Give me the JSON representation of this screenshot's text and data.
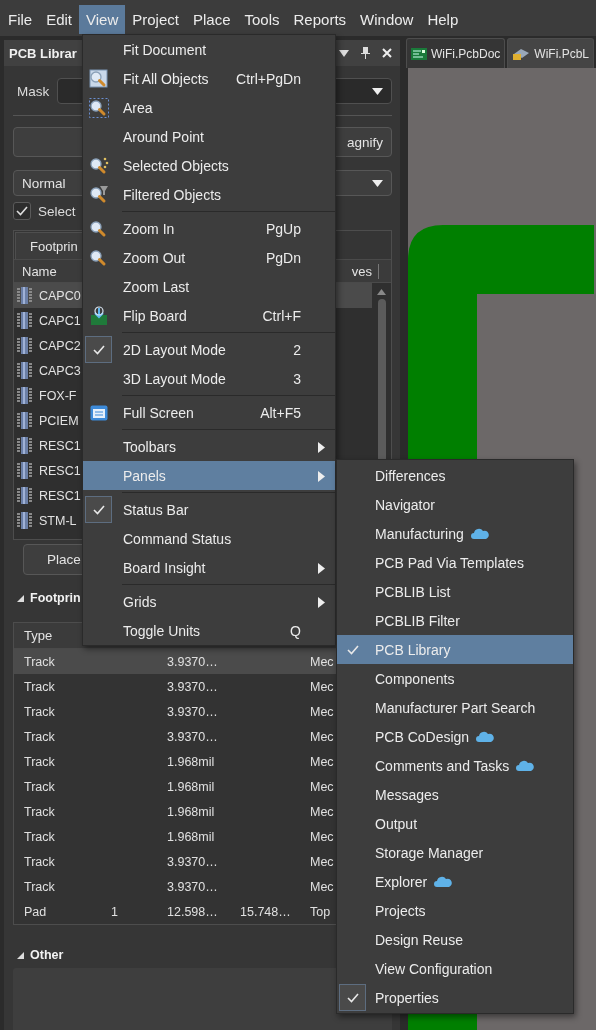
{
  "menubar": [
    {
      "label": "File",
      "selected": false
    },
    {
      "label": "Edit",
      "selected": false
    },
    {
      "label": "View",
      "selected": true
    },
    {
      "label": "Project",
      "selected": false
    },
    {
      "label": "Place",
      "selected": false
    },
    {
      "label": "Tools",
      "selected": false
    },
    {
      "label": "Reports",
      "selected": false
    },
    {
      "label": "Window",
      "selected": false
    },
    {
      "label": "Help",
      "selected": false
    }
  ],
  "panel": {
    "title": "PCB Librar",
    "mask_label": "Mask",
    "button_label": "agnify",
    "mode": "Normal",
    "select": {
      "label": "Select",
      "checked": true
    },
    "footprints": {
      "tab": "Footprin",
      "columns": [
        "Name",
        "ves"
      ],
      "rows": [
        {
          "name": "CAPC0",
          "selected": true
        },
        {
          "name": "CAPC1",
          "selected": false
        },
        {
          "name": "CAPC2",
          "selected": false
        },
        {
          "name": "CAPC3",
          "selected": false
        },
        {
          "name": "FOX-F",
          "selected": false
        },
        {
          "name": "PCIEM",
          "selected": false
        },
        {
          "name": "RESC1",
          "selected": false
        },
        {
          "name": "RESC1",
          "selected": false
        },
        {
          "name": "RESC1",
          "selected": false
        },
        {
          "name": "STM-L",
          "selected": false
        }
      ]
    },
    "place_button": "Place",
    "primitives": {
      "title": "Footprin",
      "columns": [
        "Type"
      ],
      "rows": [
        {
          "type": "Track",
          "column_3": "3.9370…",
          "column_5": "Mec",
          "selected": true
        },
        {
          "type": "Track",
          "column_3": "3.9370…",
          "column_5": "Mec",
          "selected": false
        },
        {
          "type": "Track",
          "column_3": "3.9370…",
          "column_5": "Mec",
          "selected": false
        },
        {
          "type": "Track",
          "column_3": "3.9370…",
          "column_5": "Mec",
          "selected": false
        },
        {
          "type": "Track",
          "column_3": "1.968mil",
          "column_5": "Mec",
          "selected": false
        },
        {
          "type": "Track",
          "column_3": "1.968mil",
          "column_5": "Mec",
          "selected": false
        },
        {
          "type": "Track",
          "column_3": "1.968mil",
          "column_5": "Mec",
          "selected": false
        },
        {
          "type": "Track",
          "column_3": "1.968mil",
          "column_5": "Mec",
          "selected": false
        },
        {
          "type": "Track",
          "column_3": "3.9370…",
          "column_5": "Mec",
          "selected": false
        },
        {
          "type": "Track",
          "column_3": "3.9370…",
          "column_5": "Mec",
          "selected": false
        },
        {
          "type": "Pad",
          "column_2": "1",
          "column_3": "12.598…",
          "column_4": "15.748…",
          "column_5": "Top",
          "selected": false
        }
      ]
    },
    "other_title": "Other"
  },
  "document_tabs": [
    {
      "label": "WiFi.PcbDoc",
      "selected": true
    },
    {
      "label": "WiFi.PcbL",
      "selected": false
    }
  ],
  "view_menu": [
    {
      "kind": "item",
      "label": "Fit Document",
      "checked": false,
      "submenu": false,
      "selected": false
    },
    {
      "kind": "item",
      "label": "Fit All Objects",
      "shortcut": "Ctrl+PgDn",
      "checked": false,
      "submenu": false,
      "selected": false
    },
    {
      "kind": "item",
      "label": "Area",
      "checked": false,
      "submenu": false,
      "selected": false
    },
    {
      "kind": "item",
      "label": "Around Point",
      "checked": false,
      "submenu": false,
      "selected": false
    },
    {
      "kind": "item",
      "label": "Selected Objects",
      "checked": false,
      "submenu": false,
      "selected": false
    },
    {
      "kind": "item",
      "label": "Filtered Objects",
      "checked": false,
      "submenu": false,
      "selected": false
    },
    {
      "kind": "separator"
    },
    {
      "kind": "item",
      "label": "Zoom In",
      "shortcut": "PgUp",
      "checked": false,
      "submenu": false,
      "selected": false
    },
    {
      "kind": "item",
      "label": "Zoom Out",
      "shortcut": "PgDn",
      "checked": false,
      "submenu": false,
      "selected": false
    },
    {
      "kind": "item",
      "label": "Zoom Last",
      "checked": false,
      "submenu": false,
      "selected": false
    },
    {
      "kind": "item",
      "label": "Flip Board",
      "shortcut": "Ctrl+F",
      "checked": false,
      "submenu": false,
      "selected": false
    },
    {
      "kind": "separator"
    },
    {
      "kind": "item",
      "label": "2D Layout Mode",
      "shortcut": "2",
      "checked": true,
      "submenu": false,
      "selected": false
    },
    {
      "kind": "item",
      "label": "3D Layout Mode",
      "shortcut": "3",
      "checked": false,
      "submenu": false,
      "selected": false
    },
    {
      "kind": "separator"
    },
    {
      "kind": "item",
      "label": "Full Screen",
      "shortcut": "Alt+F5",
      "checked": false,
      "submenu": false,
      "selected": false
    },
    {
      "kind": "separator"
    },
    {
      "kind": "item",
      "label": "Toolbars",
      "checked": false,
      "submenu": true,
      "selected": false
    },
    {
      "kind": "item",
      "label": "Panels",
      "checked": false,
      "submenu": true,
      "selected": true
    },
    {
      "kind": "separator"
    },
    {
      "kind": "item",
      "label": "Status Bar",
      "checked": true,
      "submenu": false,
      "selected": false
    },
    {
      "kind": "item",
      "label": "Command Status",
      "checked": false,
      "submenu": false,
      "selected": false
    },
    {
      "kind": "item",
      "label": "Board Insight",
      "checked": false,
      "submenu": true,
      "selected": false
    },
    {
      "kind": "separator"
    },
    {
      "kind": "item",
      "label": "Grids",
      "checked": false,
      "submenu": true,
      "selected": false
    },
    {
      "kind": "item",
      "label": "Toggle Units",
      "shortcut": "Q",
      "checked": false,
      "submenu": false,
      "selected": false
    }
  ],
  "panels_submenu": [
    {
      "label": "Differences",
      "checked": false,
      "cloud": false,
      "selected": false
    },
    {
      "label": "Navigator",
      "checked": false,
      "cloud": false,
      "selected": false
    },
    {
      "label": "Manufacturing",
      "checked": false,
      "cloud": true,
      "selected": false
    },
    {
      "label": "PCB Pad Via Templates",
      "checked": false,
      "cloud": false,
      "selected": false
    },
    {
      "label": "PCBLIB List",
      "checked": false,
      "cloud": false,
      "selected": false
    },
    {
      "label": "PCBLIB Filter",
      "checked": false,
      "cloud": false,
      "selected": false
    },
    {
      "label": "PCB Library",
      "checked": true,
      "cloud": false,
      "selected": true
    },
    {
      "label": "Components",
      "checked": false,
      "cloud": false,
      "selected": false
    },
    {
      "label": "Manufacturer Part Search",
      "checked": false,
      "cloud": false,
      "selected": false
    },
    {
      "label": "PCB CoDesign",
      "checked": false,
      "cloud": true,
      "selected": false
    },
    {
      "label": "Comments and Tasks",
      "checked": false,
      "cloud": true,
      "selected": false
    },
    {
      "label": "Messages",
      "checked": false,
      "cloud": false,
      "selected": false
    },
    {
      "label": "Output",
      "checked": false,
      "cloud": false,
      "selected": false
    },
    {
      "label": "Storage Manager",
      "checked": false,
      "cloud": false,
      "selected": false
    },
    {
      "label": "Explorer",
      "checked": false,
      "cloud": true,
      "selected": false
    },
    {
      "label": "Projects",
      "checked": false,
      "cloud": false,
      "selected": false
    },
    {
      "label": "Design Reuse",
      "checked": false,
      "cloud": false,
      "selected": false
    },
    {
      "label": "View Configuration",
      "checked": false,
      "cloud": false,
      "selected": false
    },
    {
      "label": "Properties",
      "checked": true,
      "cloud": false,
      "selected": false
    }
  ]
}
